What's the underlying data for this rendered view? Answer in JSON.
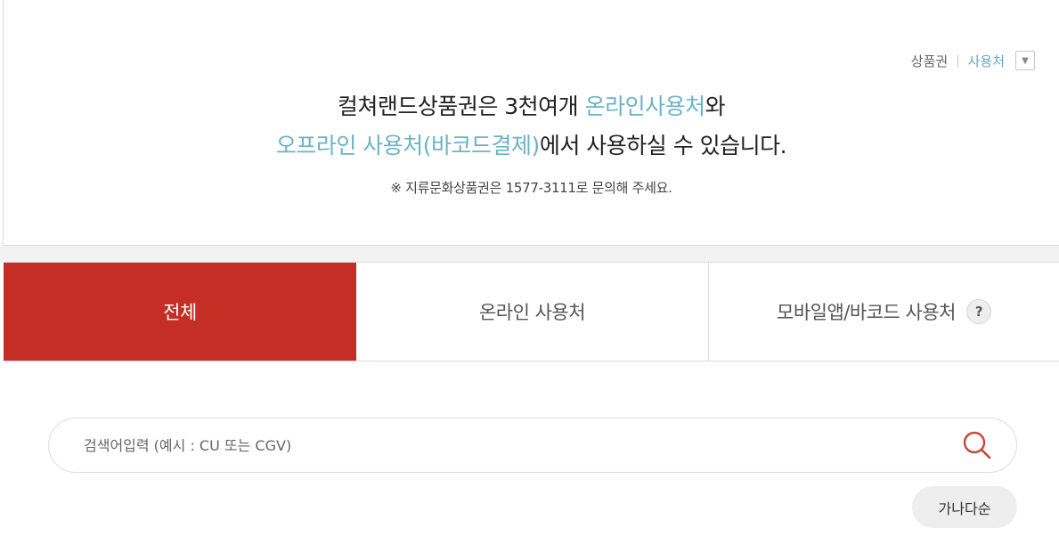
{
  "breadcrumb": {
    "item1": "상품권",
    "separator": "|",
    "item2": "사용처",
    "dropdown_icon": "▼"
  },
  "headline": {
    "line1_a": "컬쳐랜드상품권은 3천여개 ",
    "line1_hl": "온라인사용처",
    "line1_b": "와",
    "line2_hl": "오프라인 사용처(바코드결제)",
    "line2_b": "에서 사용하실 수 있습니다."
  },
  "note": "※ 지류문화상품권은 1577-3111로 문의해 주세요.",
  "tabs": [
    {
      "label": "전체",
      "active": true
    },
    {
      "label": "온라인 사용처",
      "active": false
    },
    {
      "label": "모바일앱/바코드 사용처",
      "active": false
    }
  ],
  "help_icon": "?",
  "search": {
    "placeholder": "검색어입력 (예시 : CU 또는 CGV)",
    "value": ""
  },
  "sort_button": "가나다순",
  "colors": {
    "accent": "#c42e24",
    "highlight": "#6cb3c6",
    "breadcrumb_current": "#6aa9c4"
  }
}
